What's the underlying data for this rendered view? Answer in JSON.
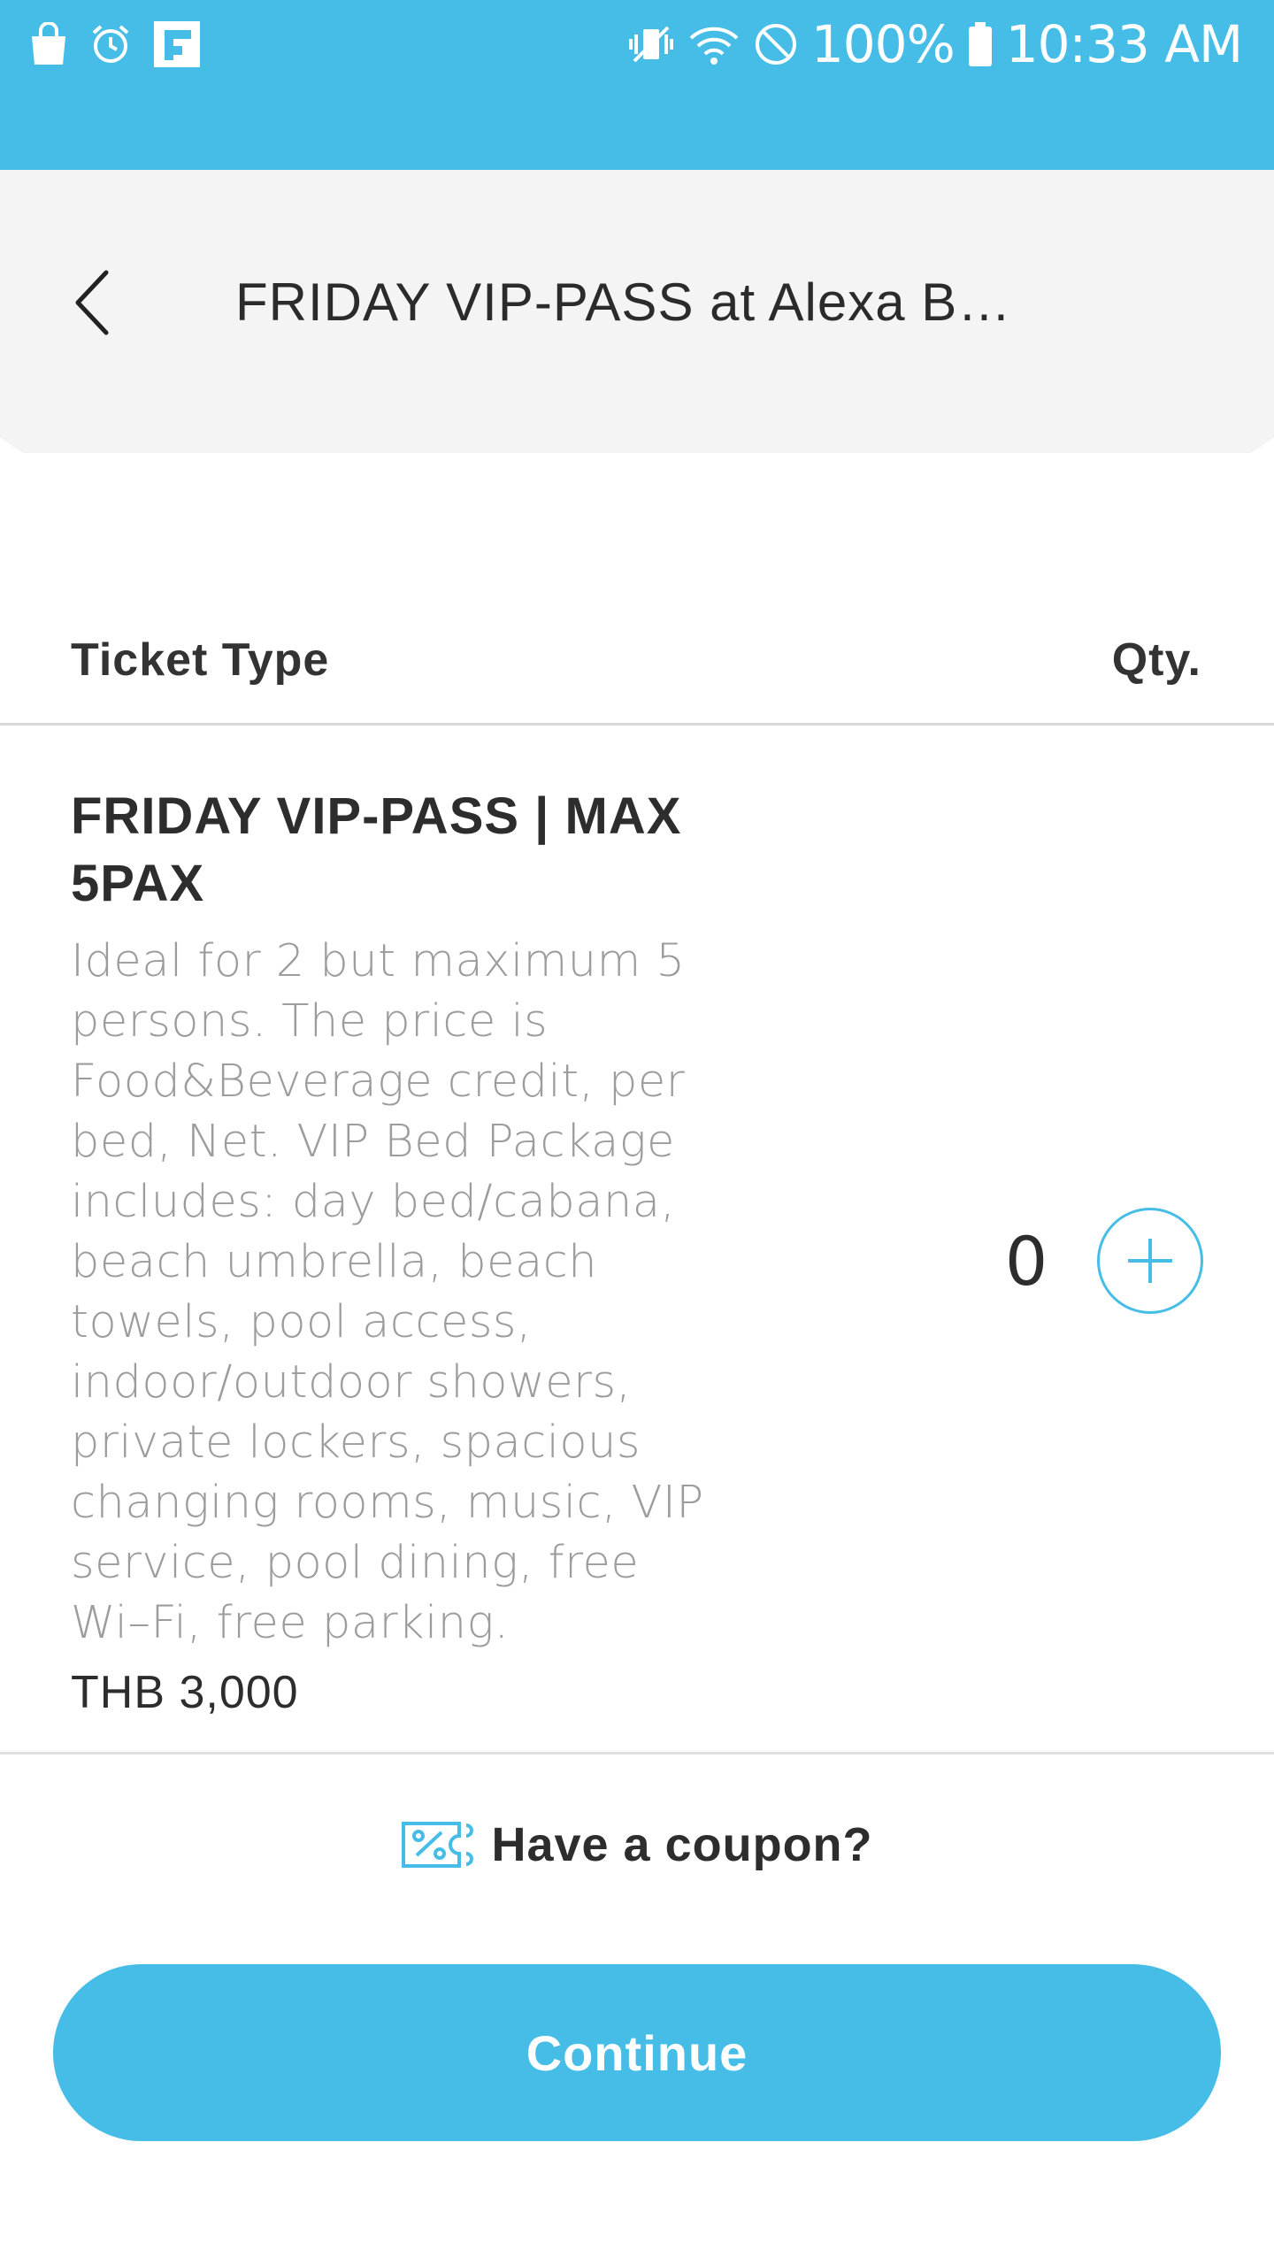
{
  "status_bar": {
    "battery": "100%",
    "time": "10:33 AM",
    "icons": [
      "shopping-bag-icon",
      "alarm-icon",
      "flipboard-icon",
      "vibrate-icon",
      "wifi-icon",
      "do-not-disturb-icon",
      "battery-icon"
    ]
  },
  "header": {
    "title": "FRIDAY VIP-PASS at Alexa B…",
    "back_icon": "chevron-left-icon"
  },
  "table": {
    "col_ticket_type": "Ticket Type",
    "col_qty": "Qty."
  },
  "ticket": {
    "name": "FRIDAY VIP-PASS | MAX 5PAX",
    "description": "Ideal for 2 but maximum 5 persons. The price is Food&Beverage credit, per bed, Net. VIP Bed Package includes: day bed/cabana, beach umbrella, beach towels, pool access, indoor/outdoor showers, private lockers, spacious changing rooms, music, VIP service, pool dining, free Wi–Fi, free parking.",
    "price": "THB 3,000",
    "qty": "0"
  },
  "coupon": {
    "label": "Have a coupon?",
    "icon": "coupon-ticket-icon"
  },
  "continue_label": "Continue",
  "colors": {
    "accent": "#45bde6",
    "header_bg": "#f4f4f4",
    "text_dark": "#2d2d2d",
    "text_muted": "#9c9c9c"
  }
}
